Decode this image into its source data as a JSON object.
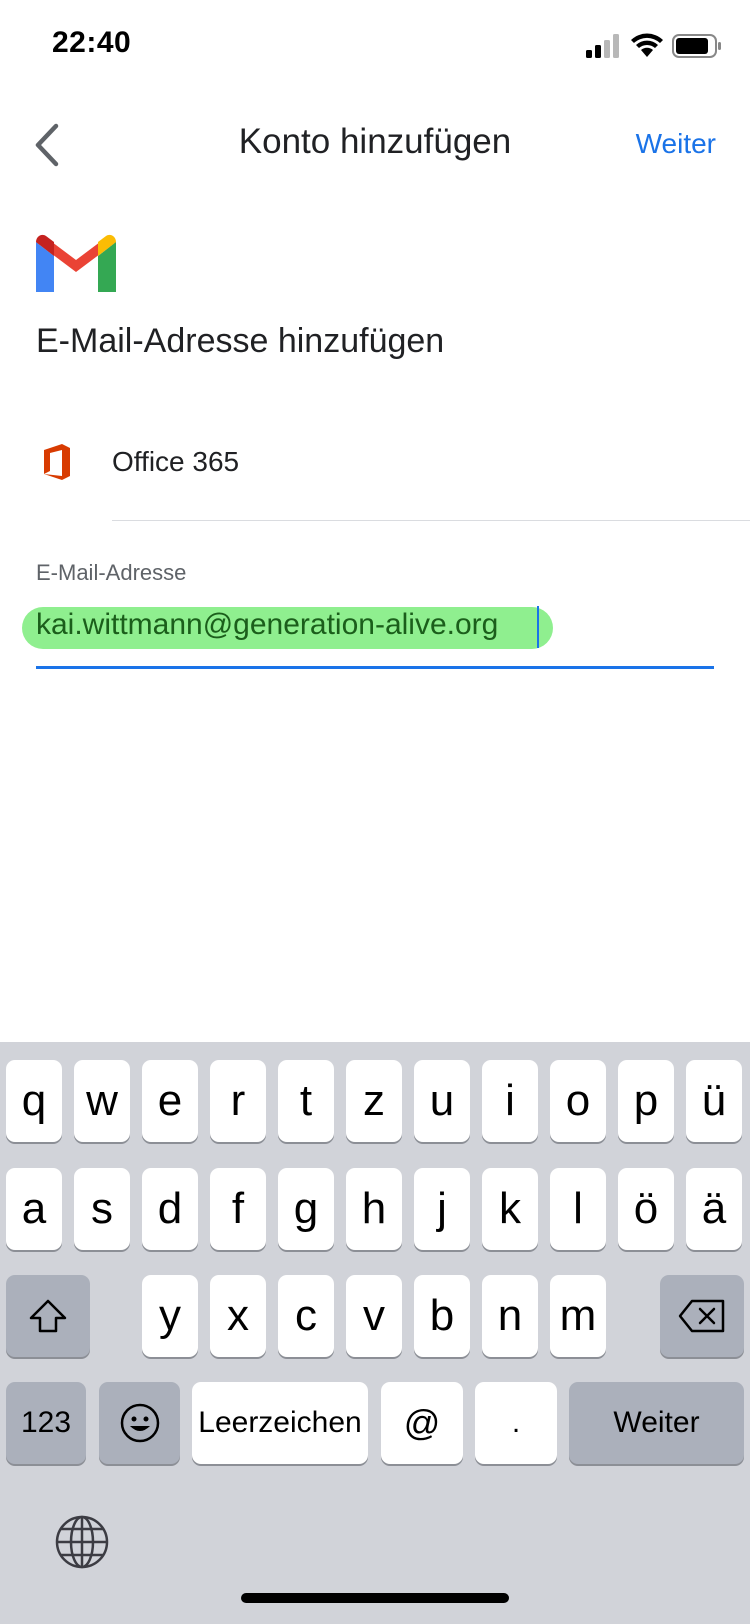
{
  "status_bar": {
    "time": "22:40"
  },
  "app_bar": {
    "title": "Konto hinzufügen",
    "next_label": "Weiter"
  },
  "heading": "E-Mail-Adresse hinzufügen",
  "provider": {
    "label": "Office 365",
    "icon": "office-365-icon"
  },
  "email_field": {
    "label": "E-Mail-Adresse",
    "value": "kai.wittmann@generation-alive.org"
  },
  "keyboard": {
    "row1": [
      "q",
      "w",
      "e",
      "r",
      "t",
      "z",
      "u",
      "i",
      "o",
      "p",
      "ü"
    ],
    "row2": [
      "a",
      "s",
      "d",
      "f",
      "g",
      "h",
      "j",
      "k",
      "l",
      "ö",
      "ä"
    ],
    "row3": [
      "y",
      "x",
      "c",
      "v",
      "b",
      "n",
      "m"
    ],
    "numbers_label": "123",
    "space_label": "Leerzeichen",
    "at_label": "@",
    "dot_label": ".",
    "return_label": "Weiter"
  },
  "colors": {
    "accent": "#1a73e8",
    "highlight": "#8fef8f",
    "keyboard_bg": "#d1d3d9"
  }
}
